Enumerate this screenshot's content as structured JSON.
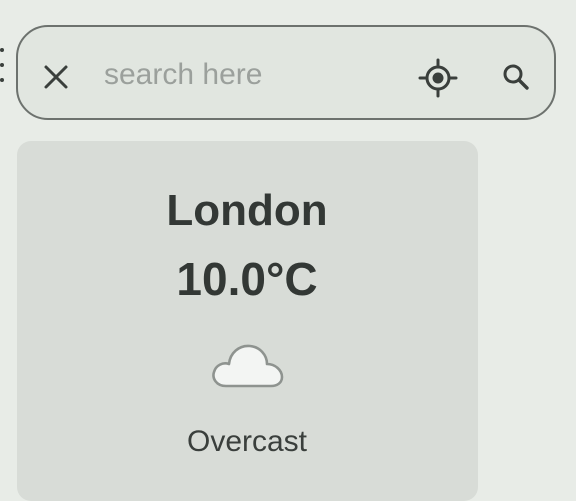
{
  "search": {
    "placeholder": "search here",
    "value": "",
    "clear_icon": "close-icon",
    "locate_icon": "my-location-icon",
    "search_icon": "search-icon"
  },
  "weather": {
    "city": "London",
    "temperature": "10.0°C",
    "condition": "Overcast",
    "condition_icon": "cloud-icon"
  },
  "colors": {
    "background": "#e8ece7",
    "search_bar_fill": "#e1e6e0",
    "search_bar_border": "#6d726e",
    "card": "#d8dcd7",
    "text": "#333835",
    "placeholder": "#9ba09c"
  }
}
